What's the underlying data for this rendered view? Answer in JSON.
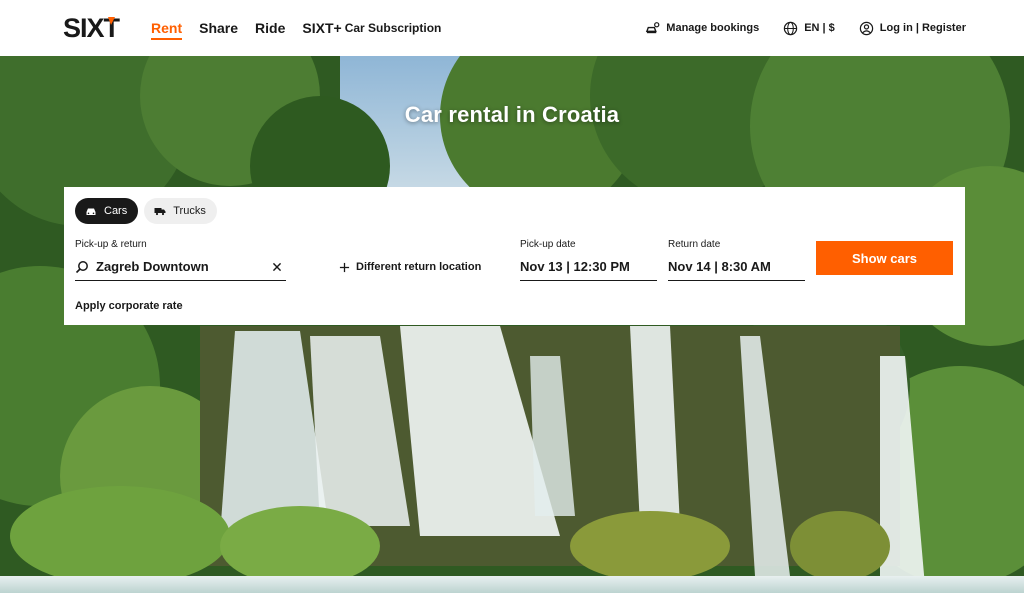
{
  "header": {
    "logo_text": "SIXT",
    "nav": [
      {
        "label": "Rent"
      },
      {
        "label": "Share"
      },
      {
        "label": "Ride"
      },
      {
        "label": "SIXT+",
        "sub": "Car Subscription"
      }
    ],
    "manage_bookings": "Manage bookings",
    "language": "EN | $",
    "login": "Log in | Register"
  },
  "hero": {
    "title": "Car rental in Croatia"
  },
  "booking": {
    "tabs": [
      {
        "label": "Cars",
        "icon": "car-icon",
        "selected": true
      },
      {
        "label": "Trucks",
        "icon": "truck-icon",
        "selected": false
      }
    ],
    "pickup_return_label": "Pick-up & return",
    "pickup_location_value": "Zagreb Downtown",
    "different_return": "Different return location",
    "pickup_date_label": "Pick-up date",
    "pickup_date_value": "Nov 13 | 12:30 PM",
    "return_date_label": "Return date",
    "return_date_value": "Nov 14 | 8:30 AM",
    "show_cars": "Show cars",
    "corporate_rate": "Apply corporate rate"
  },
  "colors": {
    "accent": "#ff5f00",
    "dark": "#191919",
    "tab_inactive_bg": "#efefef"
  }
}
